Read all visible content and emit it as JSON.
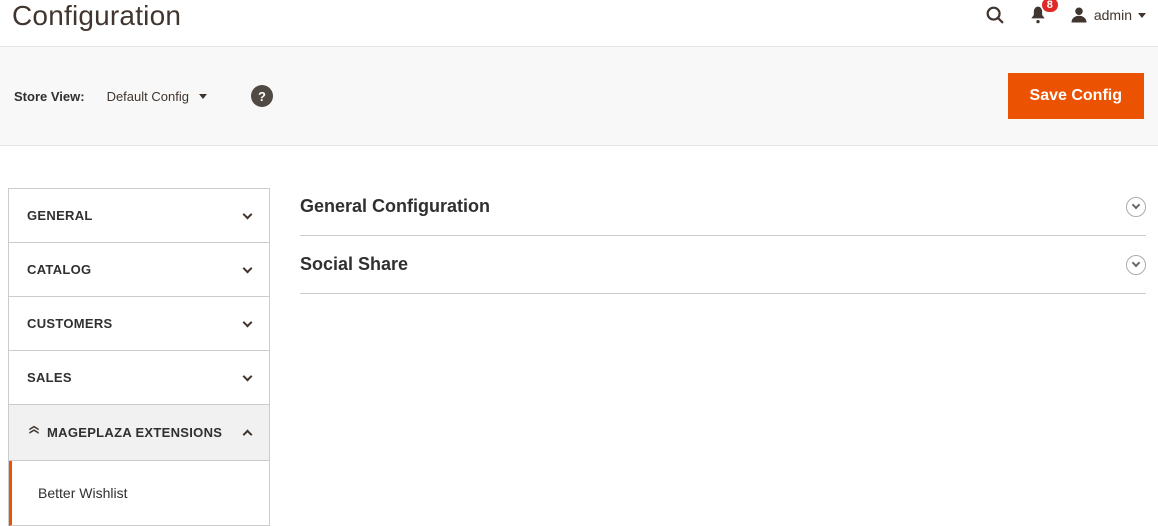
{
  "header": {
    "title": "Configuration",
    "notification_count": "8",
    "account_label": "admin"
  },
  "storebar": {
    "label": "Store View:",
    "selected": "Default Config",
    "save_label": "Save Config"
  },
  "sidebar": {
    "items": [
      {
        "label": "GENERAL",
        "expanded": false
      },
      {
        "label": "CATALOG",
        "expanded": false
      },
      {
        "label": "CUSTOMERS",
        "expanded": false
      },
      {
        "label": "SALES",
        "expanded": false
      },
      {
        "label": "MAGEPLAZA EXTENSIONS",
        "expanded": true
      }
    ],
    "active_sub": "Better Wishlist"
  },
  "sections": [
    {
      "title": "General Configuration"
    },
    {
      "title": "Social Share"
    }
  ]
}
